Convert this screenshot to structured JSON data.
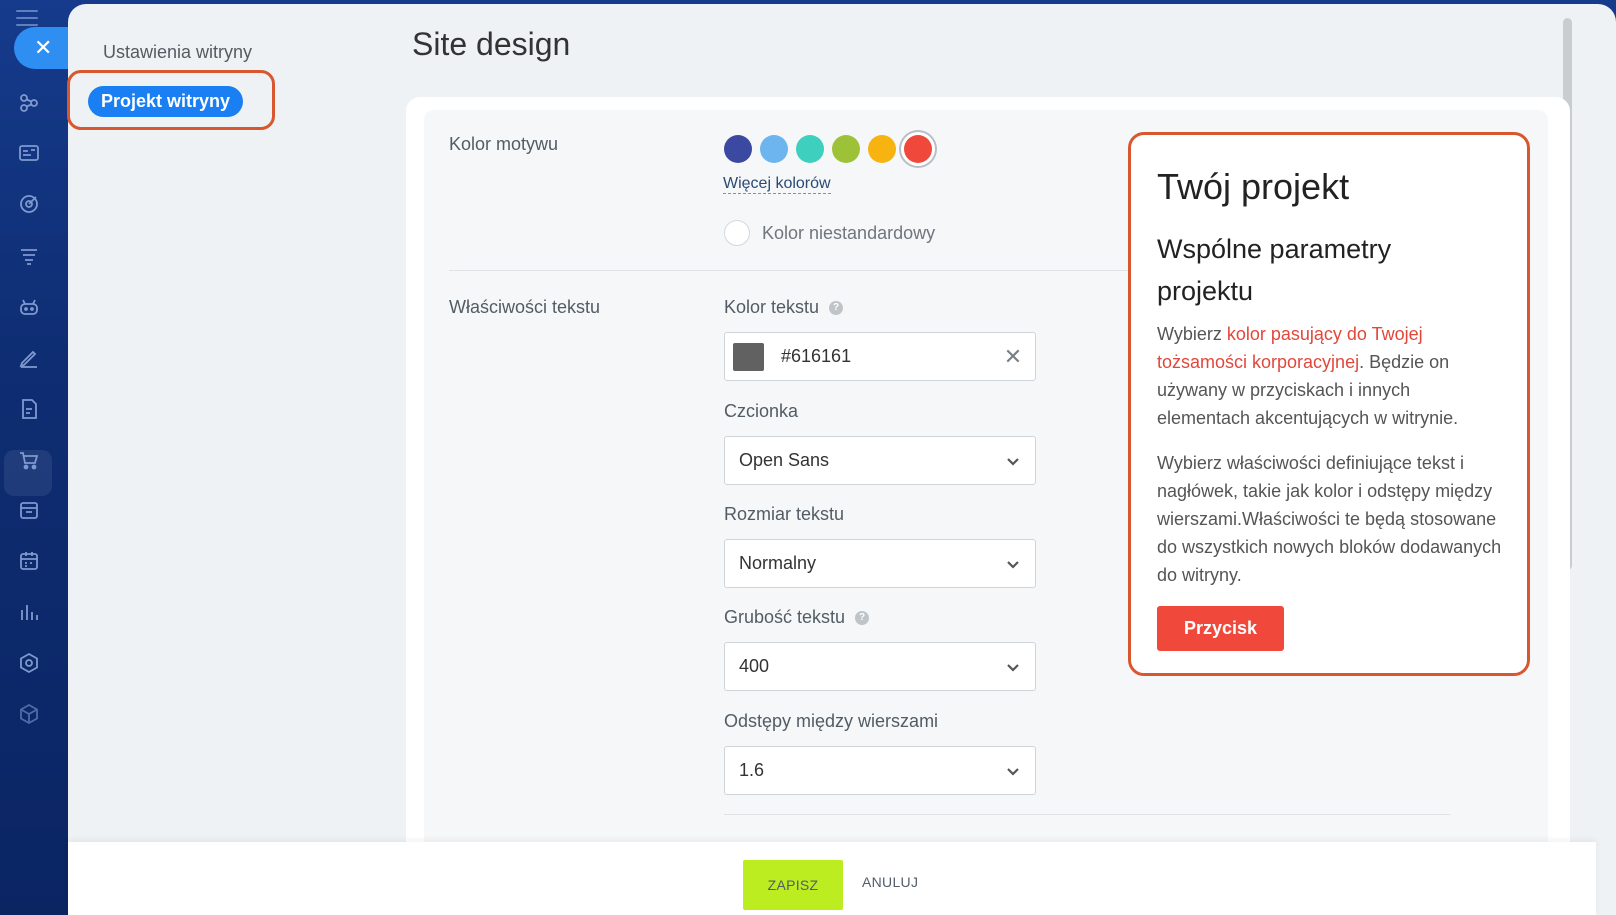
{
  "sidebar": {
    "items": [
      {
        "name": "sites-icon"
      },
      {
        "name": "crm-icon"
      },
      {
        "name": "tasks-icon"
      },
      {
        "name": "marketing-icon"
      },
      {
        "name": "robots-icon"
      },
      {
        "name": "sign-icon"
      },
      {
        "name": "docs-icon"
      },
      {
        "name": "shop-icon"
      },
      {
        "name": "inventory-icon"
      },
      {
        "name": "booking-icon"
      },
      {
        "name": "analytics-icon"
      },
      {
        "name": "automation-icon"
      },
      {
        "name": "market-icon"
      }
    ]
  },
  "nav": {
    "site_settings": "Ustawienia witryny",
    "site_design": "Projekt witryny"
  },
  "page": {
    "title": "Site design"
  },
  "theme": {
    "label": "Kolor motywu",
    "colors": [
      "#3b4aa0",
      "#6cb5ee",
      "#3fcfbe",
      "#9dc238",
      "#f7b30f",
      "#f0483a"
    ],
    "selected_index": 5,
    "more_colors": "Więcej kolorów",
    "custom_color": "Kolor niestandardowy"
  },
  "text_props": {
    "label": "Właściwości tekstu",
    "text_color_label": "Kolor tekstu",
    "text_color_value": "#616161",
    "font_label": "Czcionka",
    "font_value": "Open Sans",
    "size_label": "Rozmiar tekstu",
    "size_value": "Normalny",
    "weight_label": "Grubość tekstu",
    "weight_value": "400",
    "line_height_label": "Odstępy między wierszami",
    "line_height_value": "1.6",
    "help": "?"
  },
  "preview": {
    "title": "Twój projekt",
    "subtitle": "Wspólne parametry projektu",
    "p1_prefix": "Wybierz ",
    "p1_accent": "kolor pasujący do Twojej tożsamości korporacyjnej",
    "p1_suffix": ". Będzie on używany w przyciskach i innych elementach akcentujących w witrynie.",
    "p2": "Wybierz właściwości definiujące tekst i nagłówek, takie jak kolor i odstępy między wierszami.Właściwości te będą stosowane do wszystkich nowych bloków dodawanych do witryny.",
    "button": "Przycisk"
  },
  "footer": {
    "save": "ZAPISZ",
    "cancel": "ANULUJ"
  }
}
